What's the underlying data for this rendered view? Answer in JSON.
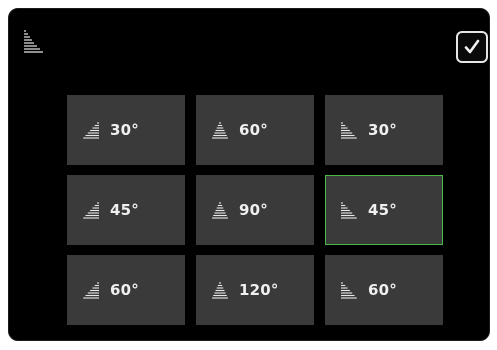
{
  "colors": {
    "dialog_bg": "#000000",
    "tile_bg": "#3a3a3a",
    "selected_border": "#4cb847",
    "text": "#f0f0f0"
  },
  "header": {
    "icon": "stair-lines-icon",
    "confirm_icon": "checkmark-icon"
  },
  "tiles": [
    {
      "label": "30°",
      "icon": "slant-right-icon",
      "selected": false
    },
    {
      "label": "60°",
      "icon": "pyramid-icon",
      "selected": false
    },
    {
      "label": "30°",
      "icon": "slant-left-icon",
      "selected": false
    },
    {
      "label": "45°",
      "icon": "slant-right-icon",
      "selected": false
    },
    {
      "label": "90°",
      "icon": "pyramid-icon",
      "selected": false
    },
    {
      "label": "45°",
      "icon": "slant-left-icon",
      "selected": true
    },
    {
      "label": "60°",
      "icon": "slant-right-icon",
      "selected": false
    },
    {
      "label": "120°",
      "icon": "pyramid-icon",
      "selected": false
    },
    {
      "label": "60°",
      "icon": "slant-left-icon",
      "selected": false
    }
  ]
}
